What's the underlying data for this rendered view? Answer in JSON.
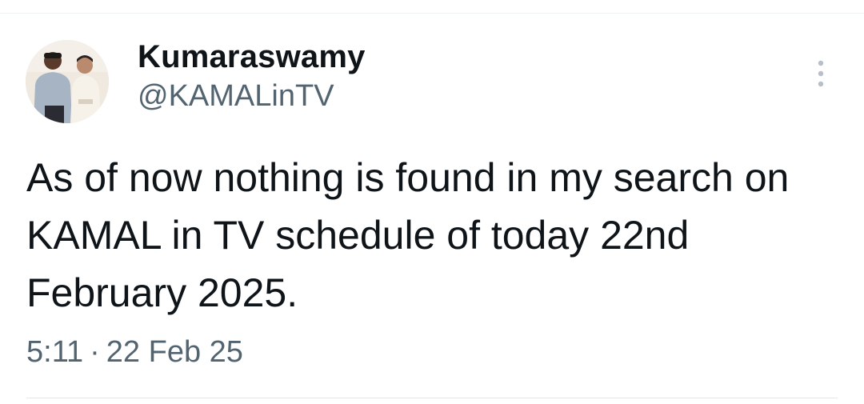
{
  "tweet": {
    "author": {
      "display_name": "Kumaraswamy",
      "handle": "@KAMALinTV",
      "avatar_icon": "avatar-photo-two-men"
    },
    "text": "As of now nothing is found in my search on KAMAL in TV schedule of today 22nd February 2025.",
    "time": "5:11",
    "separator": "·",
    "date": "22 Feb 25",
    "more_icon": "more-vertical-icon"
  },
  "colors": {
    "text_primary": "#0f1419",
    "text_secondary": "#536471",
    "divider": "#eff3f4"
  }
}
